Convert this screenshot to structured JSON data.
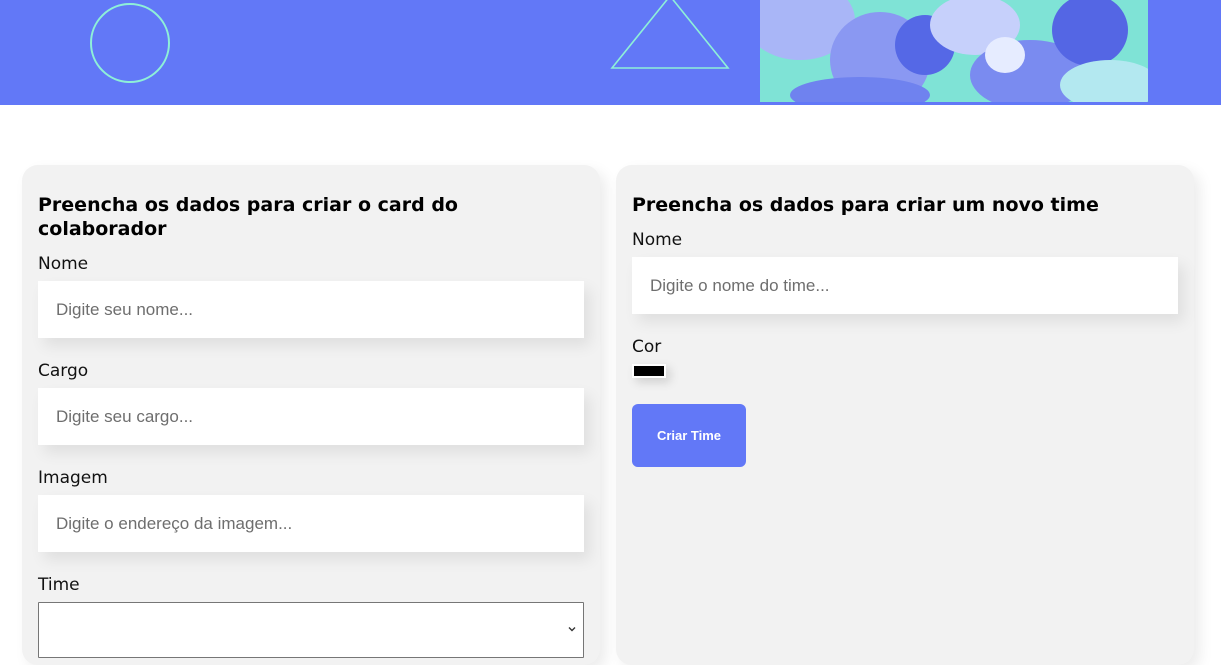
{
  "colors": {
    "banner": "#6278f7",
    "accent_line": "#8ef0d8",
    "card_bg": "#f2f2f2",
    "button": "#6278f7",
    "selected_team_color": "#000000"
  },
  "banner": {
    "decor_icons": [
      "circle-outline-icon",
      "triangle-outline-icon"
    ],
    "photo": "team-photo"
  },
  "collaborator_form": {
    "title": "Preencha os dados para criar o card do colaborador",
    "name_label": "Nome",
    "name_placeholder": "Digite seu nome...",
    "name_value": "",
    "role_label": "Cargo",
    "role_placeholder": "Digite seu cargo...",
    "role_value": "",
    "image_label": "Imagem",
    "image_placeholder": "Digite o endereço da imagem...",
    "image_value": "",
    "team_label": "Time",
    "team_selected": ""
  },
  "team_form": {
    "title": "Preencha os dados para criar um novo time",
    "name_label": "Nome",
    "name_placeholder": "Digite o nome do time...",
    "name_value": "",
    "color_label": "Cor",
    "color_value": "#000000",
    "submit_label": "Criar Time"
  }
}
